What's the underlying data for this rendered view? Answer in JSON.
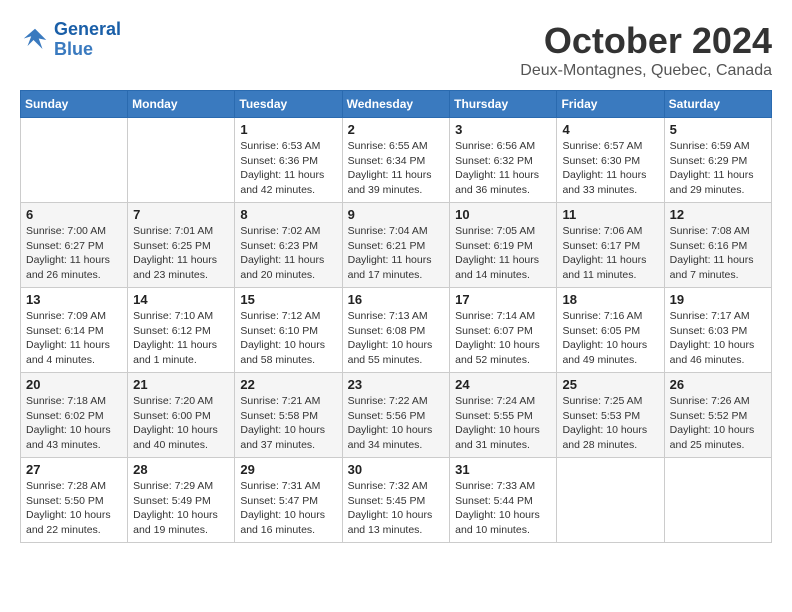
{
  "logo": {
    "line1": "General",
    "line2": "Blue"
  },
  "title": "October 2024",
  "location": "Deux-Montagnes, Quebec, Canada",
  "days_of_week": [
    "Sunday",
    "Monday",
    "Tuesday",
    "Wednesday",
    "Thursday",
    "Friday",
    "Saturday"
  ],
  "weeks": [
    [
      {
        "day": "",
        "details": ""
      },
      {
        "day": "",
        "details": ""
      },
      {
        "day": "1",
        "details": "Sunrise: 6:53 AM\nSunset: 6:36 PM\nDaylight: 11 hours and 42 minutes."
      },
      {
        "day": "2",
        "details": "Sunrise: 6:55 AM\nSunset: 6:34 PM\nDaylight: 11 hours and 39 minutes."
      },
      {
        "day": "3",
        "details": "Sunrise: 6:56 AM\nSunset: 6:32 PM\nDaylight: 11 hours and 36 minutes."
      },
      {
        "day": "4",
        "details": "Sunrise: 6:57 AM\nSunset: 6:30 PM\nDaylight: 11 hours and 33 minutes."
      },
      {
        "day": "5",
        "details": "Sunrise: 6:59 AM\nSunset: 6:29 PM\nDaylight: 11 hours and 29 minutes."
      }
    ],
    [
      {
        "day": "6",
        "details": "Sunrise: 7:00 AM\nSunset: 6:27 PM\nDaylight: 11 hours and 26 minutes."
      },
      {
        "day": "7",
        "details": "Sunrise: 7:01 AM\nSunset: 6:25 PM\nDaylight: 11 hours and 23 minutes."
      },
      {
        "day": "8",
        "details": "Sunrise: 7:02 AM\nSunset: 6:23 PM\nDaylight: 11 hours and 20 minutes."
      },
      {
        "day": "9",
        "details": "Sunrise: 7:04 AM\nSunset: 6:21 PM\nDaylight: 11 hours and 17 minutes."
      },
      {
        "day": "10",
        "details": "Sunrise: 7:05 AM\nSunset: 6:19 PM\nDaylight: 11 hours and 14 minutes."
      },
      {
        "day": "11",
        "details": "Sunrise: 7:06 AM\nSunset: 6:17 PM\nDaylight: 11 hours and 11 minutes."
      },
      {
        "day": "12",
        "details": "Sunrise: 7:08 AM\nSunset: 6:16 PM\nDaylight: 11 hours and 7 minutes."
      }
    ],
    [
      {
        "day": "13",
        "details": "Sunrise: 7:09 AM\nSunset: 6:14 PM\nDaylight: 11 hours and 4 minutes."
      },
      {
        "day": "14",
        "details": "Sunrise: 7:10 AM\nSunset: 6:12 PM\nDaylight: 11 hours and 1 minute."
      },
      {
        "day": "15",
        "details": "Sunrise: 7:12 AM\nSunset: 6:10 PM\nDaylight: 10 hours and 58 minutes."
      },
      {
        "day": "16",
        "details": "Sunrise: 7:13 AM\nSunset: 6:08 PM\nDaylight: 10 hours and 55 minutes."
      },
      {
        "day": "17",
        "details": "Sunrise: 7:14 AM\nSunset: 6:07 PM\nDaylight: 10 hours and 52 minutes."
      },
      {
        "day": "18",
        "details": "Sunrise: 7:16 AM\nSunset: 6:05 PM\nDaylight: 10 hours and 49 minutes."
      },
      {
        "day": "19",
        "details": "Sunrise: 7:17 AM\nSunset: 6:03 PM\nDaylight: 10 hours and 46 minutes."
      }
    ],
    [
      {
        "day": "20",
        "details": "Sunrise: 7:18 AM\nSunset: 6:02 PM\nDaylight: 10 hours and 43 minutes."
      },
      {
        "day": "21",
        "details": "Sunrise: 7:20 AM\nSunset: 6:00 PM\nDaylight: 10 hours and 40 minutes."
      },
      {
        "day": "22",
        "details": "Sunrise: 7:21 AM\nSunset: 5:58 PM\nDaylight: 10 hours and 37 minutes."
      },
      {
        "day": "23",
        "details": "Sunrise: 7:22 AM\nSunset: 5:56 PM\nDaylight: 10 hours and 34 minutes."
      },
      {
        "day": "24",
        "details": "Sunrise: 7:24 AM\nSunset: 5:55 PM\nDaylight: 10 hours and 31 minutes."
      },
      {
        "day": "25",
        "details": "Sunrise: 7:25 AM\nSunset: 5:53 PM\nDaylight: 10 hours and 28 minutes."
      },
      {
        "day": "26",
        "details": "Sunrise: 7:26 AM\nSunset: 5:52 PM\nDaylight: 10 hours and 25 minutes."
      }
    ],
    [
      {
        "day": "27",
        "details": "Sunrise: 7:28 AM\nSunset: 5:50 PM\nDaylight: 10 hours and 22 minutes."
      },
      {
        "day": "28",
        "details": "Sunrise: 7:29 AM\nSunset: 5:49 PM\nDaylight: 10 hours and 19 minutes."
      },
      {
        "day": "29",
        "details": "Sunrise: 7:31 AM\nSunset: 5:47 PM\nDaylight: 10 hours and 16 minutes."
      },
      {
        "day": "30",
        "details": "Sunrise: 7:32 AM\nSunset: 5:45 PM\nDaylight: 10 hours and 13 minutes."
      },
      {
        "day": "31",
        "details": "Sunrise: 7:33 AM\nSunset: 5:44 PM\nDaylight: 10 hours and 10 minutes."
      },
      {
        "day": "",
        "details": ""
      },
      {
        "day": "",
        "details": ""
      }
    ]
  ]
}
